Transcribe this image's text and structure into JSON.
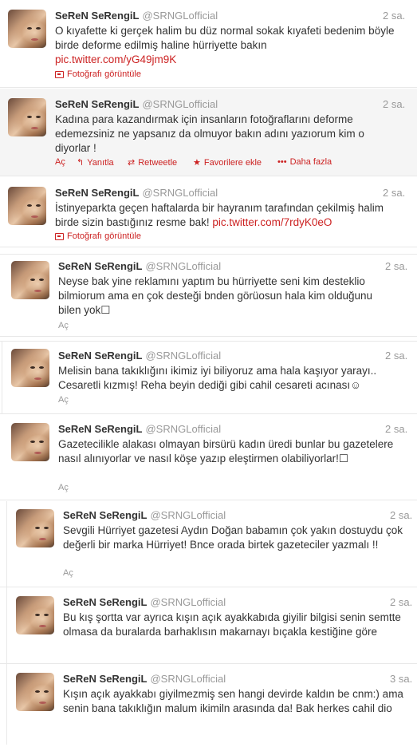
{
  "tweets": [
    {
      "name": "SeReN SeRengiL",
      "handle": "@SRNGLofficial",
      "time": "2 sa.",
      "text": "O kıyafette ki gerçek halim bu düz normal sokak kıyafeti bedenim böyle birde deforme edilmiş haline hürriyette bakın",
      "link": "pic.twitter.com/yG49jm9K",
      "photo_label": "Fotoğrafı görüntüle"
    },
    {
      "name": "SeReN SeRengiL",
      "handle": "@SRNGLofficial",
      "time": "2 sa.",
      "text": "Kadına para kazandırmak için insanların fotoğraflarını deforme edemezsiniz ne yapsanız da olmuyor bakın adını yazıorum kim o diyorlar !",
      "actions": {
        "open": "Aç",
        "reply": "Yanıtla",
        "retweet": "Retweetle",
        "favorite": "Favorilere ekle",
        "more": "Daha fazla"
      }
    },
    {
      "name": "SeReN SeRengiL",
      "handle": "@SRNGLofficial",
      "time": "2 sa.",
      "text": "İstinyeparkta geçen haftalarda bir hayranım tarafından çekilmiş halim birde sizin bastığınız resme bak!",
      "link": "pic.twitter.com/7rdyK0eO",
      "photo_label": "Fotoğrafı görüntüle"
    },
    {
      "name": "SeReN SeRengiL",
      "handle": "@SRNGLofficial",
      "time": "2 sa.",
      "text": "Neyse bak yine reklamını yaptım bu hürriyette seni kim desteklio bilmiorum ama en çok desteği bnden görüosun hala kim olduğunu bilen yok☐",
      "open": "Aç"
    },
    {
      "name": "SeReN SeRengiL",
      "handle": "@SRNGLofficial",
      "time": "2 sa.",
      "text": "Melisin bana takıklığını ikimiz iyi biliyoruz ama hala kaşıyor yarayı.. Cesaretli kızmış! Reha beyin dediği gibi cahil cesareti acınası☺",
      "open": "Aç"
    },
    {
      "name": "SeReN SeRengiL",
      "handle": "@SRNGLofficial",
      "time": "2 sa.",
      "text": "Gazetecilikle alakası olmayan birsürü kadın üredi bunlar bu gazetelere nasıl alınıyorlar ve nasıl köşe yazıp eleştirmen olabiliyorlar!☐",
      "open": "Aç"
    },
    {
      "name": "SeReN SeRengiL",
      "handle": "@SRNGLofficial",
      "time": "2 sa.",
      "text": "Sevgili Hürriyet gazetesi Aydın Doğan babamın çok yakın dostuydu çok değerli bir marka Hürriyet! Bnce orada birtek gazeteciler yazmalı !!",
      "open": "Aç"
    },
    {
      "name": "SeReN SeRengiL",
      "handle": "@SRNGLofficial",
      "time": "2 sa.",
      "text": "Bu kış şortta var ayrıca kışın açık ayakkabıda giyilir bilgisi senin semtte olmasa da buralarda barhaklısın makarnayı bıçakla kestiğine göre"
    },
    {
      "name": "SeReN SeRengiL",
      "handle": "@SRNGLofficial",
      "time": "3 sa.",
      "text": "Kışın açık ayakkabı giyilmezmiş sen hangi devirde kaldın be cnm:) ama senin bana takıklığın malum ikimiln arasında da! Bak herkes cahil dio"
    }
  ]
}
